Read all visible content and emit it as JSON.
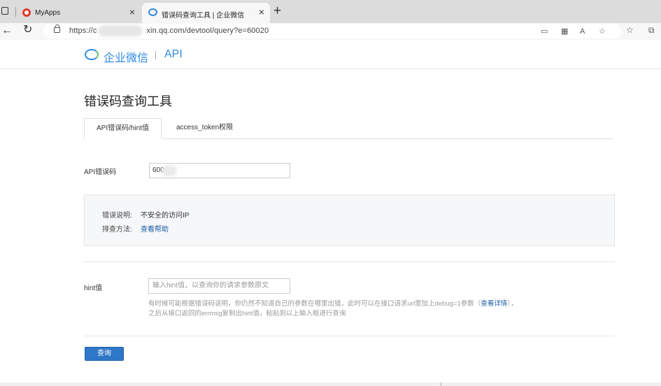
{
  "browser": {
    "tabs": [
      {
        "title": "MyApps",
        "close": "×"
      },
      {
        "title": "错误码查询工具 | 企业微信",
        "close": "×"
      }
    ],
    "new_tab": "+",
    "url_prefix": "https://c",
    "url_suffix": "xin.qq.com/devtool/query?e=60020",
    "icons": {
      "back": "←",
      "reload": "↻",
      "read_mode": "▭",
      "qr": "▦",
      "text_size": "A",
      "favorite_add": "☆",
      "favorites": "☆",
      "collections": "⧉"
    }
  },
  "header": {
    "logo_text": "企业微信",
    "section": "API"
  },
  "page": {
    "title": "错误码查询工具",
    "tabs": [
      {
        "label": "API错误码/hint值",
        "active": true
      },
      {
        "label": "access_token权限",
        "active": false
      }
    ],
    "code_label": "API错误码",
    "code_value": "600",
    "result": {
      "desc_label": "错误说明:",
      "desc_value": "不安全的访问IP",
      "help_label": "排查方法:",
      "help_link": "查看帮助"
    },
    "hint_label": "hint值",
    "hint_placeholder": "输入hint值，以查询你的请求参数原文",
    "hint_desc_1": "有时候可能根据错误码说明，你仍然不知道自己的参数在哪里出错，此时可以在接口请求url里加上debug=1参数（",
    "hint_desc_link": "查看详情",
    "hint_desc_2": "），",
    "hint_desc_3": "之后从接口返回的errmsg复制出hint值，粘贴到以上输入框进行查询",
    "query_button": "查询"
  },
  "colors": {
    "brand": "#2e8be6",
    "button": "#2e76c7",
    "link": "#1a5ea8"
  }
}
